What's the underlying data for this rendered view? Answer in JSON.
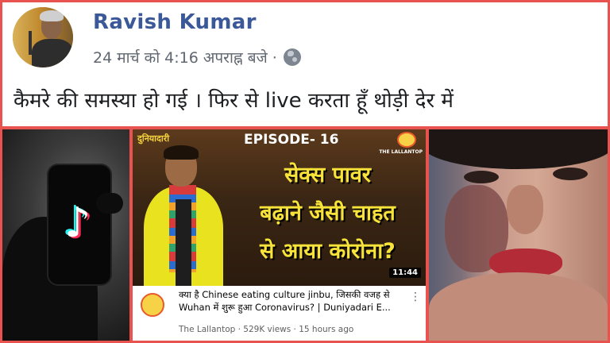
{
  "post": {
    "author": "Ravish Kumar",
    "timestamp": "24 मार्च को 4:16 अपराह्न बजे ·",
    "privacy_icon": "globe-icon",
    "text": "कैमरे की समस्या हो गई । फिर से live करता हूँ थोड़ी देर में"
  },
  "tiktok": {
    "logo_icon": "tiktok-logo-icon",
    "logo_glyph": "♪"
  },
  "youtube": {
    "thumb_tag": "दुनियादारी",
    "episode": "EPISODE- 16",
    "brand": "THE LALLANTOP",
    "thumb_lines": [
      "सेक्स पावर",
      "बढ़ाने जैसी चाहत",
      "से आया कोरोना?"
    ],
    "duration": "11:44",
    "title_line1": "क्या है Chinese eating culture jinbu, जिसकी वजह से",
    "title_line2": "Wuhan में शुरू हुआ Coronavirus? | Duniyadari E...",
    "channel": "The Lallantop",
    "views": "529K views",
    "age": "15 hours ago",
    "meta_sep": " · "
  },
  "colors": {
    "border": "#e8534f",
    "facebook_blue": "#3b5998",
    "thumb_text": "#f7e33a"
  }
}
